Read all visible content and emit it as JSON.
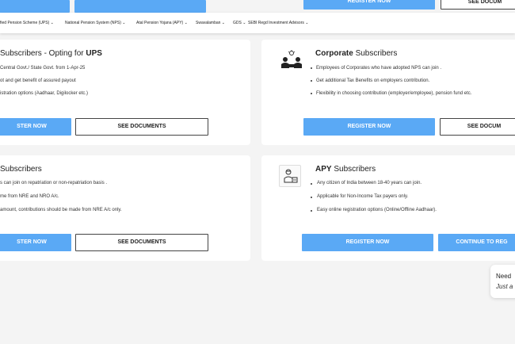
{
  "top_partial": {
    "register_label": "REGISTER NOW",
    "see_documents_label": "SEE DOCUM"
  },
  "nav": {
    "items": [
      {
        "label": "fied Pension Scheme (UPS) ⌄"
      },
      {
        "label": "National Pension System (NPS) ⌄"
      },
      {
        "label": "Atal Pension Yojana (APY) ⌄"
      },
      {
        "label": "Swavalamban ⌄"
      },
      {
        "label": "GDS ⌄"
      },
      {
        "label": "SEBI Regd Investment Advisors ⌄"
      }
    ]
  },
  "cards": {
    "ups": {
      "title_prefix": "Subscribers - Opting for ",
      "title_bold": "UPS",
      "lines": [
        "Central Govt./ State Govt. from 1-Apr-25",
        "ot and get benefit of assured payout",
        "istration options (Aadhaar, Digilocker etc.)"
      ],
      "register_label": "STER NOW",
      "documents_label": "SEE DOCUMENTS"
    },
    "corporate": {
      "title_bold": "Corporate",
      "title_suffix": " Subscribers",
      "lines": [
        "Employees of Corporates who have adopted NPS can join .",
        "Get additional Tax Benefits on employers contribution.",
        "Flexibility in choosing contribution (employer/employee), pension fund etc."
      ],
      "register_label": "REGISTER NOW",
      "documents_label": "SEE DOCUM"
    },
    "nri": {
      "title_suffix": "Subscribers",
      "lines": [
        "s can join on repatriation or non-repatriation basis .",
        "me from NRE and NRO A/c.",
        "amount, contributions should be made from NRE A/c only."
      ],
      "register_label": "STER NOW",
      "documents_label": "SEE DOCUMENTS"
    },
    "apy": {
      "title_bold": "APY",
      "title_suffix": " Subscribers",
      "lines": [
        "Any citizen of India between 18-40 years can join.",
        "Applicable for Non-Income Tax payers only.",
        "Easy online registration options (Online/Offline Aadhaar)."
      ],
      "register_label": "REGISTER NOW",
      "continue_label": "CONTINUE TO REG"
    }
  },
  "help_widget": {
    "title": "Need",
    "subtitle": "Just a"
  }
}
